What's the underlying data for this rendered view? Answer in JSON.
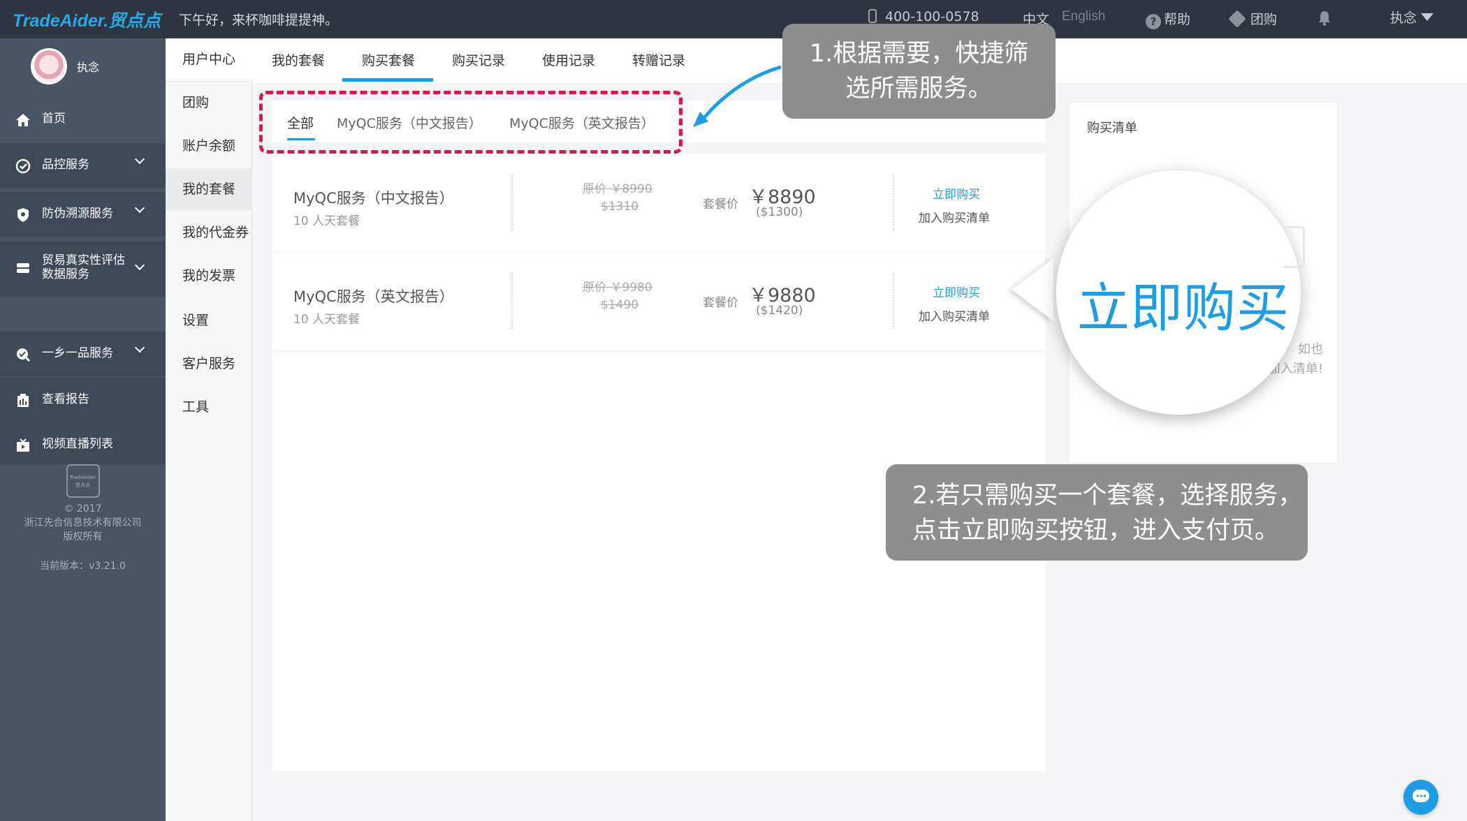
{
  "topbar": {
    "logo": "TradeAider.贸点点",
    "greeting": "下午好，来杯咖啡提提神。",
    "phone": "400-100-0578",
    "lang_zh": "中文",
    "lang_en": "English",
    "help": "帮助",
    "group_buy": "团购",
    "user": "执念"
  },
  "sidebar": {
    "username": "执念",
    "items": [
      {
        "label": "首页",
        "icon": "home-icon"
      },
      {
        "label": "品控服务",
        "icon": "quality-control-icon"
      },
      {
        "label": "防伪溯源服务",
        "icon": "shield-icon"
      },
      {
        "label": "贸易真实性评估\n数据服务",
        "icon": "handshake-icon"
      },
      {
        "label": "一乡一品服务",
        "icon": "search-badge-icon"
      },
      {
        "label": "查看报告",
        "icon": "report-icon"
      },
      {
        "label": "视频直播列表",
        "icon": "video-icon"
      }
    ],
    "footer": {
      "logo_text": "TradeAider 贸点点",
      "copyright_year": "© 2017",
      "company": "浙江先合信息技术有限公司",
      "rights": "版权所有",
      "version": "当前版本：v3.21.0"
    }
  },
  "subnav": {
    "items": [
      "用户中心",
      "团购",
      "账户余额",
      "我的套餐",
      "我的代金券",
      "我的发票",
      "设置",
      "客户服务",
      "工具"
    ],
    "active_index": 3
  },
  "tabs": {
    "items": [
      "我的套餐",
      "购买套餐",
      "购买记录",
      "使用记录",
      "转赠记录"
    ],
    "active_index": 1
  },
  "filter": {
    "items": [
      "全部",
      "MyQC服务（中文报告）",
      "MyQC服务（英文报告）"
    ],
    "active_index": 0
  },
  "packages": [
    {
      "name": "MyQC服务（中文报告）",
      "sub": "10 人天套餐",
      "orig_price": "原价 ￥8990",
      "orig_usd": "$1310",
      "price_label": "套餐价",
      "price": "￥8890",
      "price_usd": "($1300)",
      "buy_now": "立即购买",
      "add_cart": "加入购买清单"
    },
    {
      "name": "MyQC服务（英文报告）",
      "sub": "10 人天套餐",
      "orig_price": "原价 ￥9980",
      "orig_usd": "$1490",
      "price_label": "套餐价",
      "price": "￥9880",
      "price_usd": "($1420)",
      "buy_now": "立即购买",
      "add_cart": "加入购买清单"
    }
  ],
  "cart": {
    "title": "购买清单",
    "empty_line1": "如也",
    "empty_line2": "加入清单!"
  },
  "callouts": {
    "step1_line1": "1.根据需要，快捷筛",
    "step1_line2": "选所需服务。",
    "step2_line1": "2.若只需购买一个套餐，选择服务，",
    "step2_line2": "点击立即购买按钮，进入支付页。",
    "magnifier_text": "立即购买"
  },
  "colors": {
    "accent": "#1e9de3",
    "topbar_bg": "#2e3440",
    "sidebar_bg": "#4a5465",
    "highlight_dash": "#d9184b",
    "callout_bg": "#8e8e8e"
  }
}
